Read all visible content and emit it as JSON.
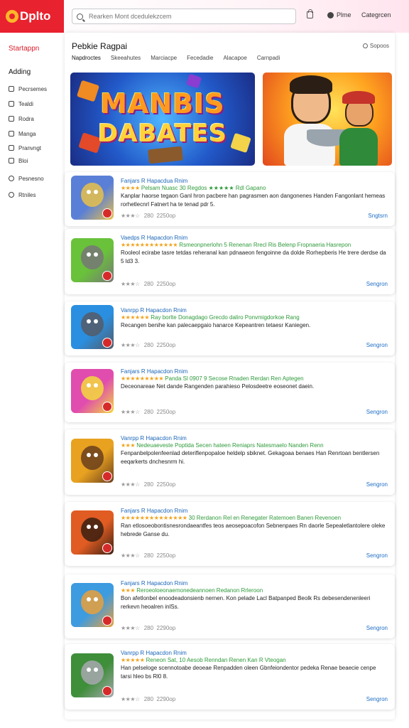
{
  "app": {
    "name": "Dplto"
  },
  "search": {
    "placeholder": "Rearken Mont dcedulekzcem"
  },
  "nav": {
    "home": "Plme",
    "categories": "Categrcen"
  },
  "sidebar": {
    "title": "Startappn",
    "subtitle": "Adding",
    "items": [
      {
        "label": "Pecrsemes",
        "icon": "grid-icon"
      },
      {
        "label": "Tealdi",
        "icon": "box-icon"
      },
      {
        "label": "Rodra",
        "icon": "box-icon"
      },
      {
        "label": "Manga",
        "icon": "box-icon"
      },
      {
        "label": "Pranvngt",
        "icon": "box-icon"
      },
      {
        "label": "Bloi",
        "icon": "box-icon"
      },
      {
        "label": "Pesnesno",
        "icon": "circle-icon"
      },
      {
        "label": "Rtniles",
        "icon": "circle-icon"
      }
    ]
  },
  "main": {
    "title": "Pebkie Ragpai",
    "filter_label": "Sopoos",
    "tabs": [
      "Napdroctes",
      "Skeeahutes",
      "Marciacpe",
      "Fecedadie",
      "Alacapoe",
      "Carnpadi"
    ]
  },
  "banners": [
    {
      "line1": "MANBIS",
      "line2": "DABATES"
    },
    {
      "line1": "",
      "line2": ""
    }
  ],
  "colors": {
    "brand": "#e8222f",
    "link": "#1f6fc6",
    "star": "#f2a21a"
  },
  "cards": [
    {
      "name": "Fanjars R Hapacdua Rnim",
      "meta_stars": "★★★★",
      "meta": "Pelsam Nuasc 30 Regdos ★★★★★ Rdl Gapano",
      "desc": "Kanplar haorse tegaon Ganl hron pacbere han pagrasmen aon dangonenes Handen Fangonlant hemeas rorhetlecnrl Fatnert ha te tenad pdr 5.",
      "rating": "280",
      "count": "2250op",
      "link": "Sngtsrn",
      "thumb_a": "#5a7fd6",
      "thumb_b": "#e8c14a"
    },
    {
      "name": "Vaedps R Hapacdon Rnim",
      "meta_stars": "★★★★★★★★★★★★",
      "meta": "Rsmeonpnerlohn 5 Renenan Rrecl Ris Belenp Fropnaeria Hasrepon",
      "desc": "Rooleol ecirabe tasre tetdas reheranal kan pdnaaeon fengoinne da dolde Rorhepberis He trere derdse da 5 ld3 3.",
      "rating": "280",
      "count": "2250op",
      "link": "Sengron",
      "thumb_a": "#69c23a",
      "thumb_b": "#777777"
    },
    {
      "name": "Vanrpp R Hapacdon Rnim",
      "meta_stars": "★★★★★★",
      "meta": "Ray borlte Donagdago Grecdo daliro Ponvmigdorkoe Rang",
      "desc": "Recangen benihe kan palecaepgaio hanarce Kepeantren tetaesr Kaniegen.",
      "rating": "280",
      "count": "2250op",
      "link": "Sengron",
      "thumb_a": "#2a8fe0",
      "thumb_b": "#555a66"
    },
    {
      "name": "Fanjars R Hapacdon Rnim",
      "meta_stars": "★★★★★★★★★",
      "meta": "Panda Sl 0907 9 Secose Rnaden Rerdan Ren Aptegen",
      "desc": "Deceonareae Net dande Rangenden parahieso Pelosdeetre eoseonet daein.",
      "rating": "280",
      "count": "2250op",
      "link": "Sengron",
      "thumb_a": "#e04dae",
      "thumb_b": "#f3d93c"
    },
    {
      "name": "Vanrpp R Hapacdon Rnim",
      "meta_stars": "★★★",
      "meta": "Nedeuaeveste Poptida Secen hateen Reniaprs Natesmaelo Nanden Renn",
      "desc": "Fenpanbelpolenfeenlad deteriflenpopaloe heldelp sbiknet. Gekagoaa benaes Han Renrtoan bentlersen eeqarkerts dnchesnrm hi.",
      "rating": "280",
      "count": "2250op",
      "link": "Sengron",
      "thumb_a": "#e8a220",
      "thumb_b": "#6a3e1c"
    },
    {
      "name": "Fanjars R Hapacdon Rnim",
      "meta_stars": "★★★★★★★★★★★★★★",
      "meta": "30 Rerdanon Rel en Renegater Ratemoen Banen Revenoen",
      "desc": "Ran etlosoeobontisnesrondaeantfes teos aeosepoacofon Sebnenpaes Rn daorle Sepealetlantolere oleke hebrede Ganse du.",
      "rating": "280",
      "count": "2250op",
      "link": "Sengron",
      "thumb_a": "#e05c23",
      "thumb_b": "#3a1f10"
    },
    {
      "name": "Fanjars R Hapacdon Rnim",
      "meta_stars": "★★★",
      "meta": "Reroeoloeonaemonedeannoen Redanon Rrleroon",
      "desc": "Bon afetlonbel enoodeadonsienb nernen. Kon pelade Lacl Batpanped Beolk Rs debesendenenleeri rerkevn heoalren inlSs.",
      "rating": "280",
      "count": "2290op",
      "link": "Sengron",
      "thumb_a": "#3d9be0",
      "thumb_b": "#e9a03b"
    },
    {
      "name": "Vanrpp R Hapacdon Rnim",
      "meta_stars": "★★★★★",
      "meta": "Reneon Sat, 10 Aesob Renndan Renen Kan R Vteogan",
      "desc": "Han pelseloge scennotoabe deoeae Renpadden oleen Gbnfeiondentor pedeka Renae beaecie cenpe tarsi hleo bs Rl0 8.",
      "rating": "280",
      "count": "2290op",
      "link": "Sengron",
      "thumb_a": "#3e8e3a",
      "thumb_b": "#a8a8b0"
    }
  ]
}
